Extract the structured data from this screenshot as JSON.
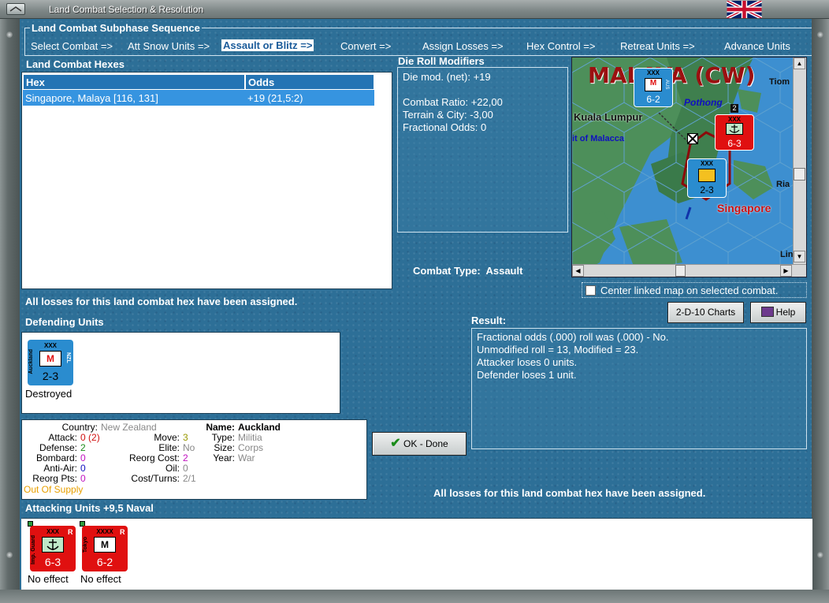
{
  "window": {
    "title": "Land Combat Selection & Resolution"
  },
  "subphase": {
    "label": "Land Combat Subphase Sequence",
    "steps": [
      {
        "label": "Select Combat =>"
      },
      {
        "label": "Att Snow Units =>"
      },
      {
        "label": "Assault or Blitz =>",
        "active": true
      },
      {
        "label": "Convert =>"
      },
      {
        "label": "Assign Losses =>"
      },
      {
        "label": "Hex Control =>"
      },
      {
        "label": "Retreat Units =>"
      },
      {
        "label": "Advance Units"
      }
    ]
  },
  "hexes": {
    "label": "Land Combat Hexes",
    "columns": [
      "Hex",
      "Odds"
    ],
    "rows": [
      {
        "hex": "Singapore, Malaya [116, 131]",
        "odds": "+19 (21,5:2)"
      }
    ]
  },
  "die_roll": {
    "label": "Die Roll Modifiers",
    "lines": [
      "Die mod. (net): +19",
      "",
      "Combat Ratio: +22,00",
      "Terrain & City: -3,00",
      "Fractional Odds: 0"
    ]
  },
  "map": {
    "labels": {
      "region": "MALAYA (CW)",
      "kuala": "Kuala Lumpur",
      "strait": "it of Malacca",
      "pothong": "Pothong",
      "singapore": "Singapore",
      "tiom": "Tiom",
      "ria": "Ria",
      "lin": "Lin"
    },
    "counters": [
      {
        "name": "aus-counter",
        "top": "XXX",
        "side": "Sydney",
        "right": "AUS",
        "flag": "R",
        "strength": "6-2",
        "color": "#2a8ccf",
        "symbol": "M"
      },
      {
        "name": "imp-guard-counter",
        "top": "XXX",
        "side": "Imp. Guard",
        "flag": "R",
        "strength": "6-3",
        "color": "#e01010",
        "symbol": "anchor"
      },
      {
        "name": "auckland-map-counter",
        "top": "XXX",
        "side": "Auckland",
        "right": "NZL",
        "strength": "2-3",
        "color": "#2a8ccf",
        "symbol": "M"
      }
    ],
    "stack_count": "2"
  },
  "combat_type": {
    "label": "Combat Type:",
    "value": "Assault"
  },
  "center_map": {
    "label": "Center linked map on selected combat.",
    "checked": false
  },
  "buttons": {
    "charts": "2-D-10 Charts",
    "help": "Help",
    "ok": "OK - Done"
  },
  "losses_msg": "All losses for this land combat hex have been assigned.",
  "losses_msg2": "All losses for this land combat hex have been assigned.",
  "defending": {
    "label": "Defending Units",
    "units": [
      {
        "top": "XXX",
        "side": "Auckland",
        "right": "NZL",
        "strength": "2-3",
        "symbol": "M",
        "color": "#2a8ccf",
        "status": "Destroyed"
      }
    ]
  },
  "result": {
    "label": "Result:",
    "lines": [
      "Fractional odds (.000) roll was (.000)  - No.",
      "Unmodified roll = 13, Modified = 23.",
      "Attacker loses 0 units.",
      "Defender loses 1 unit."
    ]
  },
  "unit_details": {
    "country_label": "Country:",
    "country": "New Zealand",
    "attack_label": "Attack:",
    "attack": "0",
    "attack_paren": "(2)",
    "defense_label": "Defense:",
    "defense": "2",
    "bombard_label": "Bombard:",
    "bombard": "0",
    "antiair_label": "Anti-Air:",
    "antiair": "0",
    "reorgpts_label": "Reorg Pts:",
    "reorgpts": "0",
    "supply": "Out Of Supply",
    "move_label": "Move:",
    "move": "3",
    "elite_label": "Elite:",
    "elite": "No",
    "reorgcost_label": "Reorg Cost:",
    "reorgcost": "2",
    "oil_label": "Oil:",
    "oil": "0",
    "costturns_label": "Cost/Turns:",
    "costturns": "2/1",
    "name_label": "Name:",
    "name": "Auckland",
    "type_label": "Type:",
    "type": "Militia",
    "size_label": "Size:",
    "size": "Corps",
    "year_label": "Year:",
    "year": "War"
  },
  "attacking": {
    "label": "Attacking Units +9,5 Naval",
    "units": [
      {
        "top": "XXX",
        "side": "Imp. Guard",
        "flag": "R",
        "strength": "6-3",
        "symbol": "anchor",
        "color": "#e01010",
        "status": "No effect"
      },
      {
        "top": "XXXX",
        "side": "Tokyo",
        "flag": "R",
        "strength": "6-2",
        "symbol": "M",
        "color": "#e01010",
        "status": "No effect"
      }
    ]
  },
  "colors": {
    "panel": "#2d6f97",
    "selected": "#3694e0",
    "attacker": "#e01010",
    "defender": "#2a8ccf",
    "supply": "#e8a000"
  }
}
